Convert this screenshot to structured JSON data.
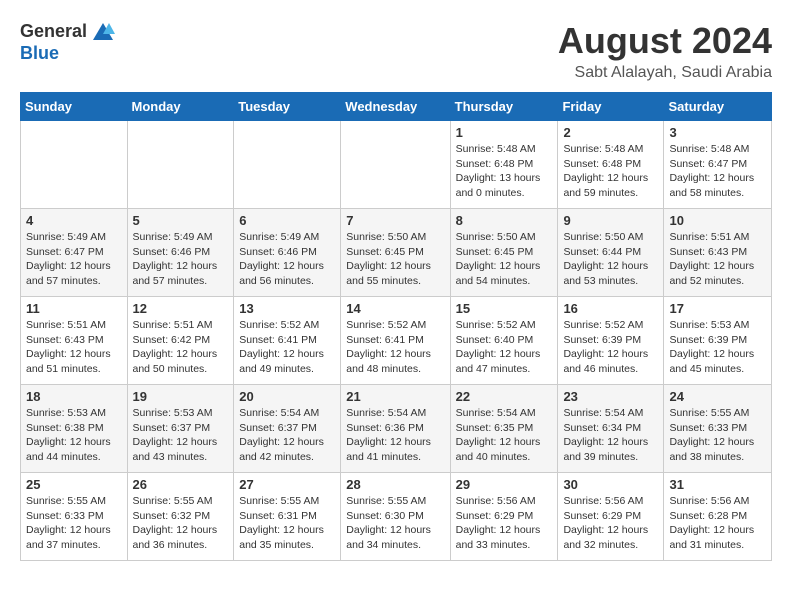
{
  "logo": {
    "general": "General",
    "blue": "Blue"
  },
  "header": {
    "month_year": "August 2024",
    "location": "Sabt Alalayah, Saudi Arabia"
  },
  "days_of_week": [
    "Sunday",
    "Monday",
    "Tuesday",
    "Wednesday",
    "Thursday",
    "Friday",
    "Saturday"
  ],
  "weeks": [
    [
      {
        "day": "",
        "info": ""
      },
      {
        "day": "",
        "info": ""
      },
      {
        "day": "",
        "info": ""
      },
      {
        "day": "",
        "info": ""
      },
      {
        "day": "1",
        "info": "Sunrise: 5:48 AM\nSunset: 6:48 PM\nDaylight: 13 hours\nand 0 minutes."
      },
      {
        "day": "2",
        "info": "Sunrise: 5:48 AM\nSunset: 6:48 PM\nDaylight: 12 hours\nand 59 minutes."
      },
      {
        "day": "3",
        "info": "Sunrise: 5:48 AM\nSunset: 6:47 PM\nDaylight: 12 hours\nand 58 minutes."
      }
    ],
    [
      {
        "day": "4",
        "info": "Sunrise: 5:49 AM\nSunset: 6:47 PM\nDaylight: 12 hours\nand 57 minutes."
      },
      {
        "day": "5",
        "info": "Sunrise: 5:49 AM\nSunset: 6:46 PM\nDaylight: 12 hours\nand 57 minutes."
      },
      {
        "day": "6",
        "info": "Sunrise: 5:49 AM\nSunset: 6:46 PM\nDaylight: 12 hours\nand 56 minutes."
      },
      {
        "day": "7",
        "info": "Sunrise: 5:50 AM\nSunset: 6:45 PM\nDaylight: 12 hours\nand 55 minutes."
      },
      {
        "day": "8",
        "info": "Sunrise: 5:50 AM\nSunset: 6:45 PM\nDaylight: 12 hours\nand 54 minutes."
      },
      {
        "day": "9",
        "info": "Sunrise: 5:50 AM\nSunset: 6:44 PM\nDaylight: 12 hours\nand 53 minutes."
      },
      {
        "day": "10",
        "info": "Sunrise: 5:51 AM\nSunset: 6:43 PM\nDaylight: 12 hours\nand 52 minutes."
      }
    ],
    [
      {
        "day": "11",
        "info": "Sunrise: 5:51 AM\nSunset: 6:43 PM\nDaylight: 12 hours\nand 51 minutes."
      },
      {
        "day": "12",
        "info": "Sunrise: 5:51 AM\nSunset: 6:42 PM\nDaylight: 12 hours\nand 50 minutes."
      },
      {
        "day": "13",
        "info": "Sunrise: 5:52 AM\nSunset: 6:41 PM\nDaylight: 12 hours\nand 49 minutes."
      },
      {
        "day": "14",
        "info": "Sunrise: 5:52 AM\nSunset: 6:41 PM\nDaylight: 12 hours\nand 48 minutes."
      },
      {
        "day": "15",
        "info": "Sunrise: 5:52 AM\nSunset: 6:40 PM\nDaylight: 12 hours\nand 47 minutes."
      },
      {
        "day": "16",
        "info": "Sunrise: 5:52 AM\nSunset: 6:39 PM\nDaylight: 12 hours\nand 46 minutes."
      },
      {
        "day": "17",
        "info": "Sunrise: 5:53 AM\nSunset: 6:39 PM\nDaylight: 12 hours\nand 45 minutes."
      }
    ],
    [
      {
        "day": "18",
        "info": "Sunrise: 5:53 AM\nSunset: 6:38 PM\nDaylight: 12 hours\nand 44 minutes."
      },
      {
        "day": "19",
        "info": "Sunrise: 5:53 AM\nSunset: 6:37 PM\nDaylight: 12 hours\nand 43 minutes."
      },
      {
        "day": "20",
        "info": "Sunrise: 5:54 AM\nSunset: 6:37 PM\nDaylight: 12 hours\nand 42 minutes."
      },
      {
        "day": "21",
        "info": "Sunrise: 5:54 AM\nSunset: 6:36 PM\nDaylight: 12 hours\nand 41 minutes."
      },
      {
        "day": "22",
        "info": "Sunrise: 5:54 AM\nSunset: 6:35 PM\nDaylight: 12 hours\nand 40 minutes."
      },
      {
        "day": "23",
        "info": "Sunrise: 5:54 AM\nSunset: 6:34 PM\nDaylight: 12 hours\nand 39 minutes."
      },
      {
        "day": "24",
        "info": "Sunrise: 5:55 AM\nSunset: 6:33 PM\nDaylight: 12 hours\nand 38 minutes."
      }
    ],
    [
      {
        "day": "25",
        "info": "Sunrise: 5:55 AM\nSunset: 6:33 PM\nDaylight: 12 hours\nand 37 minutes."
      },
      {
        "day": "26",
        "info": "Sunrise: 5:55 AM\nSunset: 6:32 PM\nDaylight: 12 hours\nand 36 minutes."
      },
      {
        "day": "27",
        "info": "Sunrise: 5:55 AM\nSunset: 6:31 PM\nDaylight: 12 hours\nand 35 minutes."
      },
      {
        "day": "28",
        "info": "Sunrise: 5:55 AM\nSunset: 6:30 PM\nDaylight: 12 hours\nand 34 minutes."
      },
      {
        "day": "29",
        "info": "Sunrise: 5:56 AM\nSunset: 6:29 PM\nDaylight: 12 hours\nand 33 minutes."
      },
      {
        "day": "30",
        "info": "Sunrise: 5:56 AM\nSunset: 6:29 PM\nDaylight: 12 hours\nand 32 minutes."
      },
      {
        "day": "31",
        "info": "Sunrise: 5:56 AM\nSunset: 6:28 PM\nDaylight: 12 hours\nand 31 minutes."
      }
    ]
  ]
}
